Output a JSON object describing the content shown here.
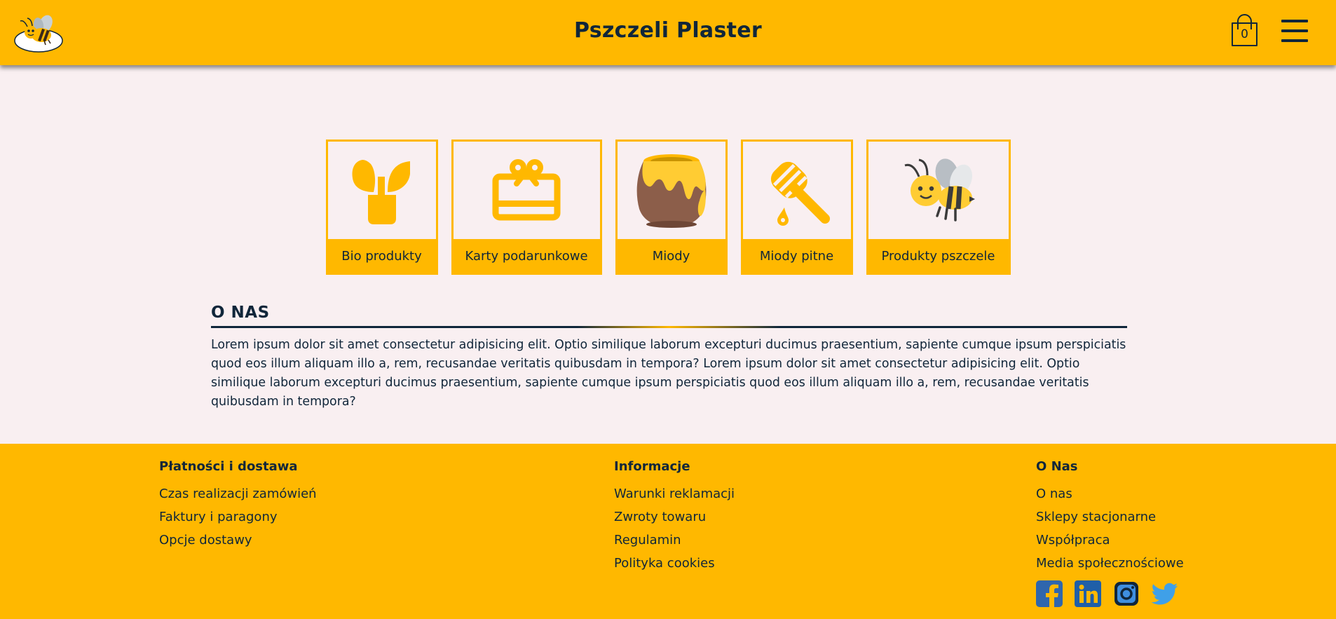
{
  "header": {
    "title": "Pszczeli Plaster",
    "cart_count": "0",
    "logo_icon": "bee-logo-icon",
    "cart_icon": "shopping-bag-icon",
    "menu_icon": "hamburger-menu-icon"
  },
  "categories": [
    {
      "label": "Bio produkty",
      "icon": "plant-icon"
    },
    {
      "label": "Karty podarunkowe",
      "icon": "gift-card-icon"
    },
    {
      "label": "Miody",
      "icon": "honey-pot-icon"
    },
    {
      "label": "Miody pitne",
      "icon": "honey-dipper-icon"
    },
    {
      "label": "Produkty pszczele",
      "icon": "bee-icon"
    }
  ],
  "about": {
    "heading": "O NAS",
    "text": "Lorem ipsum dolor sit amet consectetur adipisicing elit. Optio similique laborum excepturi ducimus praesentium, sapiente cumque ipsum perspiciatis quod eos illum aliquam illo a, rem, recusandae veritatis quibusdam in tempora? Lorem ipsum dolor sit amet consectetur adipisicing elit. Optio similique laborum excepturi ducimus praesentium, sapiente cumque ipsum perspiciatis quod eos illum aliquam illo a, rem, recusandae veritatis quibusdam in tempora?"
  },
  "footer": {
    "col1": {
      "title": "Płatności i dostawa",
      "links": [
        "Czas realizacji zamówień",
        "Faktury i paragony",
        "Opcje dostawy"
      ]
    },
    "col2": {
      "title": "Informacje",
      "links": [
        "Warunki reklamacji",
        "Zwroty towaru",
        "Regulamin",
        "Polityka cookies"
      ]
    },
    "col3": {
      "title": "O Nas",
      "links": [
        "O nas",
        "Sklepy stacjonarne",
        "Współpraca",
        "Media społecznościowe"
      ]
    },
    "social": [
      "facebook-icon",
      "linkedin-icon",
      "instagram-icon",
      "twitter-icon"
    ]
  },
  "colors": {
    "accent": "#ffb800",
    "text": "#10263a",
    "background": "#f9eff1"
  }
}
